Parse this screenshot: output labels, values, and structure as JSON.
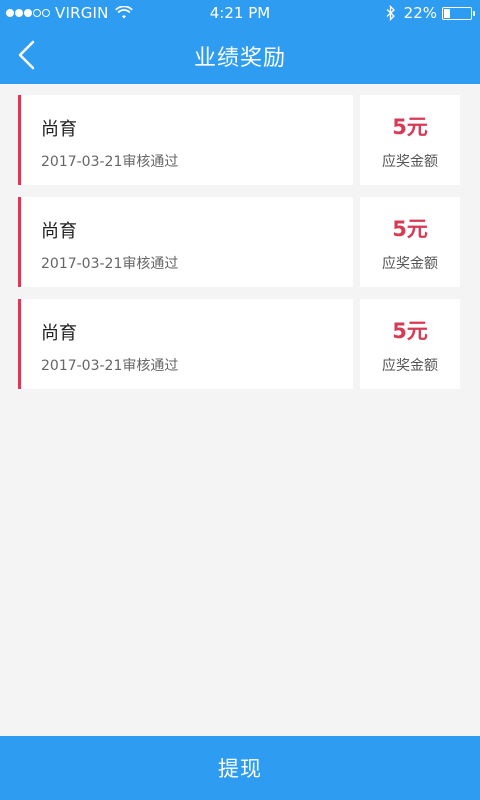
{
  "status_bar": {
    "carrier": "VIRGIN",
    "time": "4:21 PM",
    "battery": "22%",
    "battery_level": 0.22,
    "signal_bars": 3
  },
  "nav": {
    "title": "业绩奖励",
    "back_icon": "chevron-left-icon"
  },
  "rewards": [
    {
      "name": "尚育",
      "date": "2017-03-21审核通过",
      "amount": "5元",
      "amount_label": "应奖金额"
    },
    {
      "name": "尚育",
      "date": "2017-03-21审核通过",
      "amount": "5元",
      "amount_label": "应奖金额"
    },
    {
      "name": "尚育",
      "date": "2017-03-21审核通过",
      "amount": "5元",
      "amount_label": "应奖金额"
    }
  ],
  "footer": {
    "withdraw_label": "提现"
  },
  "colors": {
    "primary": "#2e9cf0",
    "accent": "#d83a55",
    "background": "#f4f4f4"
  }
}
